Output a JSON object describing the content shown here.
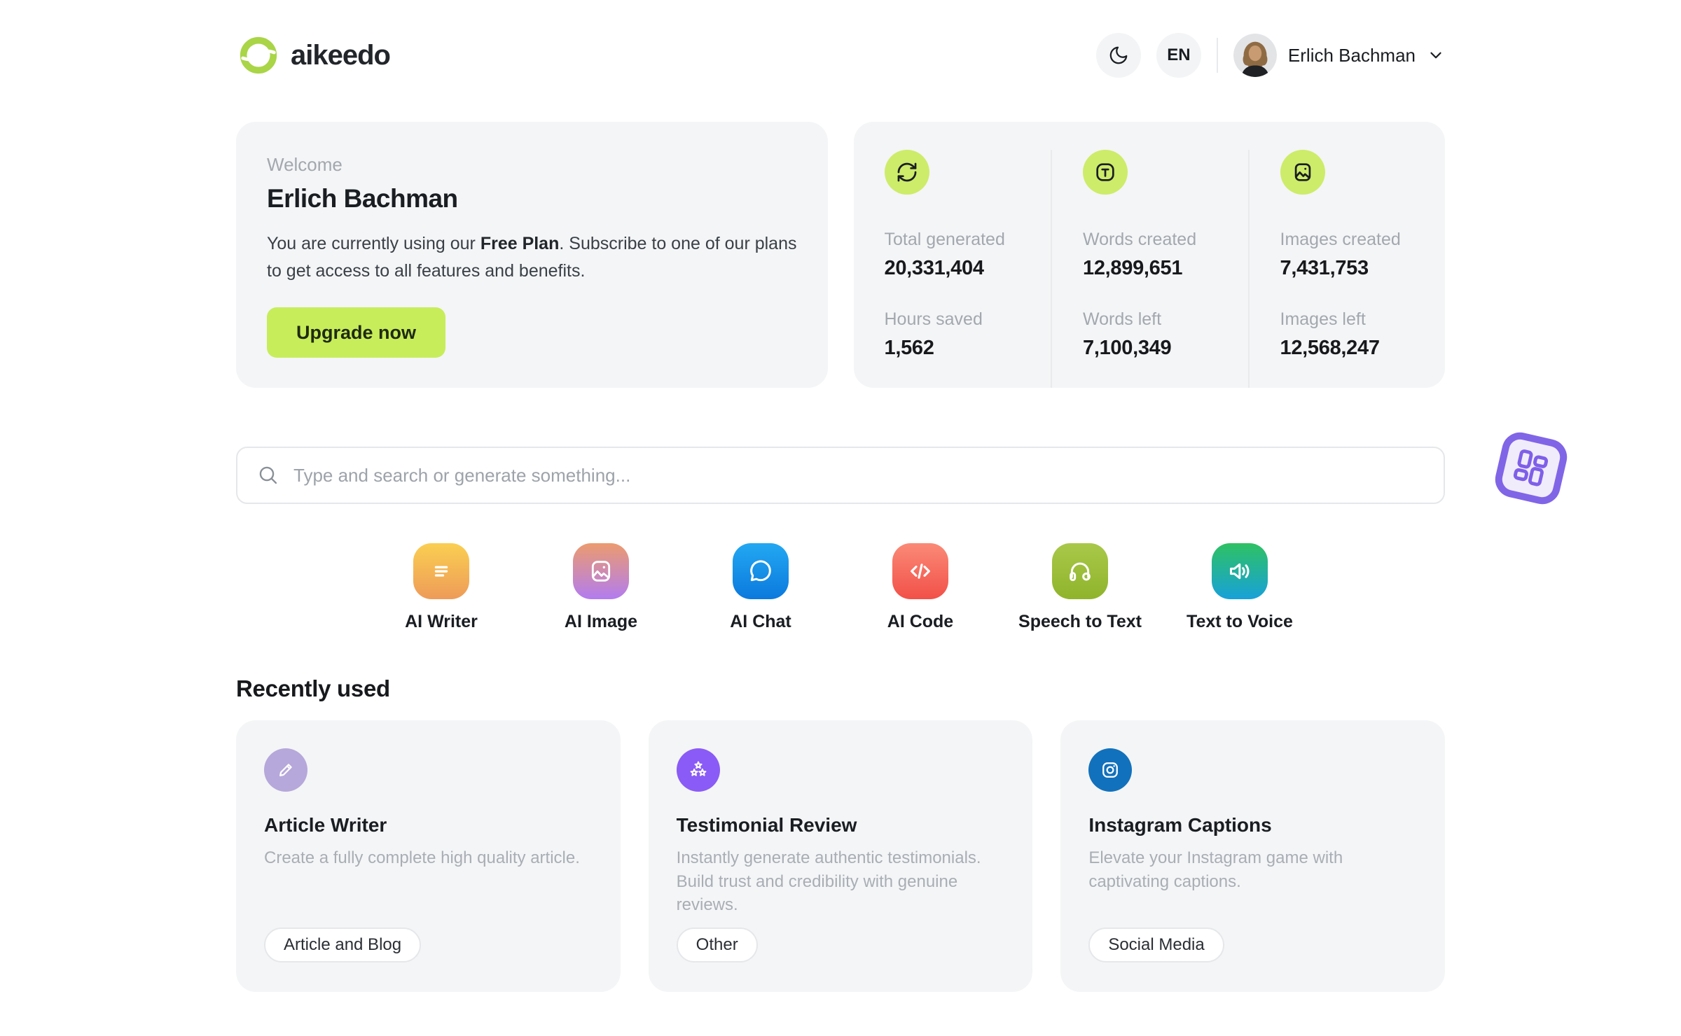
{
  "header": {
    "brand": "aikeedo",
    "language": "EN",
    "user_name": "Erlich Bachman"
  },
  "welcome": {
    "eyebrow": "Welcome",
    "name": "Erlich Bachman",
    "message_prefix": "You are currently using our ",
    "plan": "Free Plan",
    "message_suffix": ". Subscribe to one of our plans to get access to all features and benefits.",
    "cta": "Upgrade now"
  },
  "stats": {
    "columns": [
      {
        "icon": "refresh-icon",
        "top_label": "Total generated",
        "top_value": "20,331,404",
        "bottom_label": "Hours saved",
        "bottom_value": "1,562"
      },
      {
        "icon": "text-icon",
        "top_label": "Words created",
        "top_value": "12,899,651",
        "bottom_label": "Words left",
        "bottom_value": "7,100,349"
      },
      {
        "icon": "image-icon",
        "top_label": "Images created",
        "top_value": "7,431,753",
        "bottom_label": "Images left",
        "bottom_value": "12,568,247"
      }
    ]
  },
  "search": {
    "placeholder": "Type and search or generate something..."
  },
  "tools": [
    {
      "label": "AI Writer",
      "bg": "linear-gradient(180deg, #FACF52, #EE9B58)"
    },
    {
      "label": "AI Image",
      "bg": "linear-gradient(180deg, #EC9B6F, #B27CF0)"
    },
    {
      "label": "AI Chat",
      "bg": "linear-gradient(180deg, #23A8F2, #0B79DD)"
    },
    {
      "label": "AI Code",
      "bg": "linear-gradient(180deg, #FA8A77, #F25048)"
    },
    {
      "label": "Speech to Text",
      "bg": "linear-gradient(180deg, #A9C84A, #8FB42B)"
    },
    {
      "label": "Text to Voice",
      "bg": "linear-gradient(180deg, #2EC163, #18A1D9)"
    }
  ],
  "recent": {
    "heading": "Recently used",
    "cards": [
      {
        "title": "Article Writer",
        "description": "Create a fully complete high quality article.",
        "tag": "Article and Blog",
        "icon_bg": "#B6A8DA"
      },
      {
        "title": "Testimonial Review",
        "description": "Instantly generate authentic testimonials. Build trust and credibility with genuine reviews.",
        "tag": "Other",
        "icon_bg": "#8A5BF6"
      },
      {
        "title": "Instagram Captions",
        "description": "Elevate your Instagram game with captivating captions.",
        "tag": "Social Media",
        "icon_bg": "#1271BC"
      }
    ]
  },
  "colors": {
    "accent_lime": "#C7ED5A",
    "stat_icon_bg": "#CDEC69",
    "card_bg": "#F4F5F6",
    "sticker_purple": "#8065E7"
  }
}
